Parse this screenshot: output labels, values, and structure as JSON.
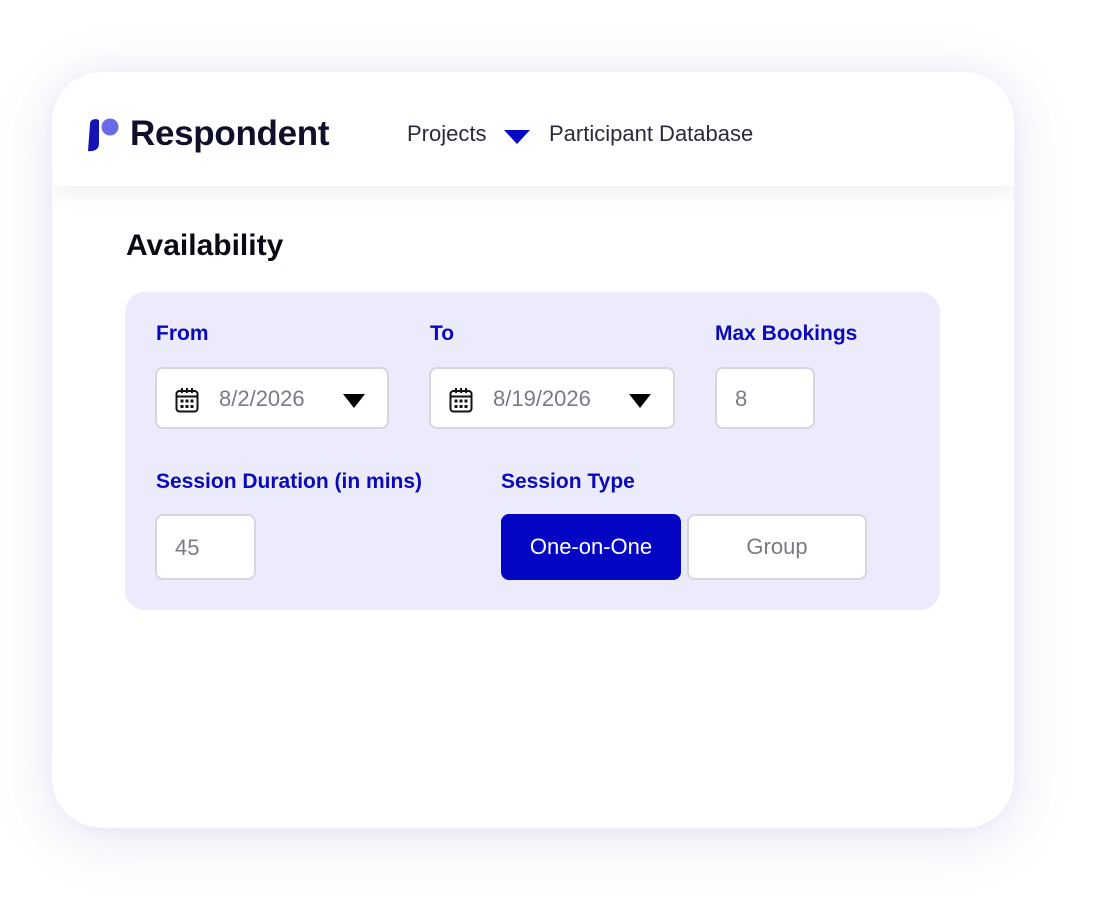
{
  "header": {
    "brand": "Respondent",
    "nav": {
      "projects_label": "Projects",
      "participants_label": "Participant Database"
    }
  },
  "page": {
    "title": "Availability"
  },
  "form": {
    "from": {
      "label": "From",
      "value": "8/2/2026"
    },
    "to": {
      "label": "To",
      "value": "8/19/2026"
    },
    "max_bookings": {
      "label": "Max Bookings",
      "value": "8"
    },
    "session_duration": {
      "label": "Session Duration (in mins)",
      "value": "45"
    },
    "session_type": {
      "label": "Session Type",
      "options": [
        "One-on-One",
        "Group"
      ],
      "selected": "One-on-One"
    }
  },
  "icons": {
    "logo": "respondent-logo-icon",
    "nav_dropdown": "caret-down-icon",
    "date": "calendar-icon",
    "date_dropdown": "caret-down-icon"
  },
  "colors": {
    "accent": "#0505C4",
    "label": "#0A0AB8",
    "panel": "#EBEBFC",
    "logo_dark": "#1414B8",
    "logo_light": "#6B6BE8"
  }
}
